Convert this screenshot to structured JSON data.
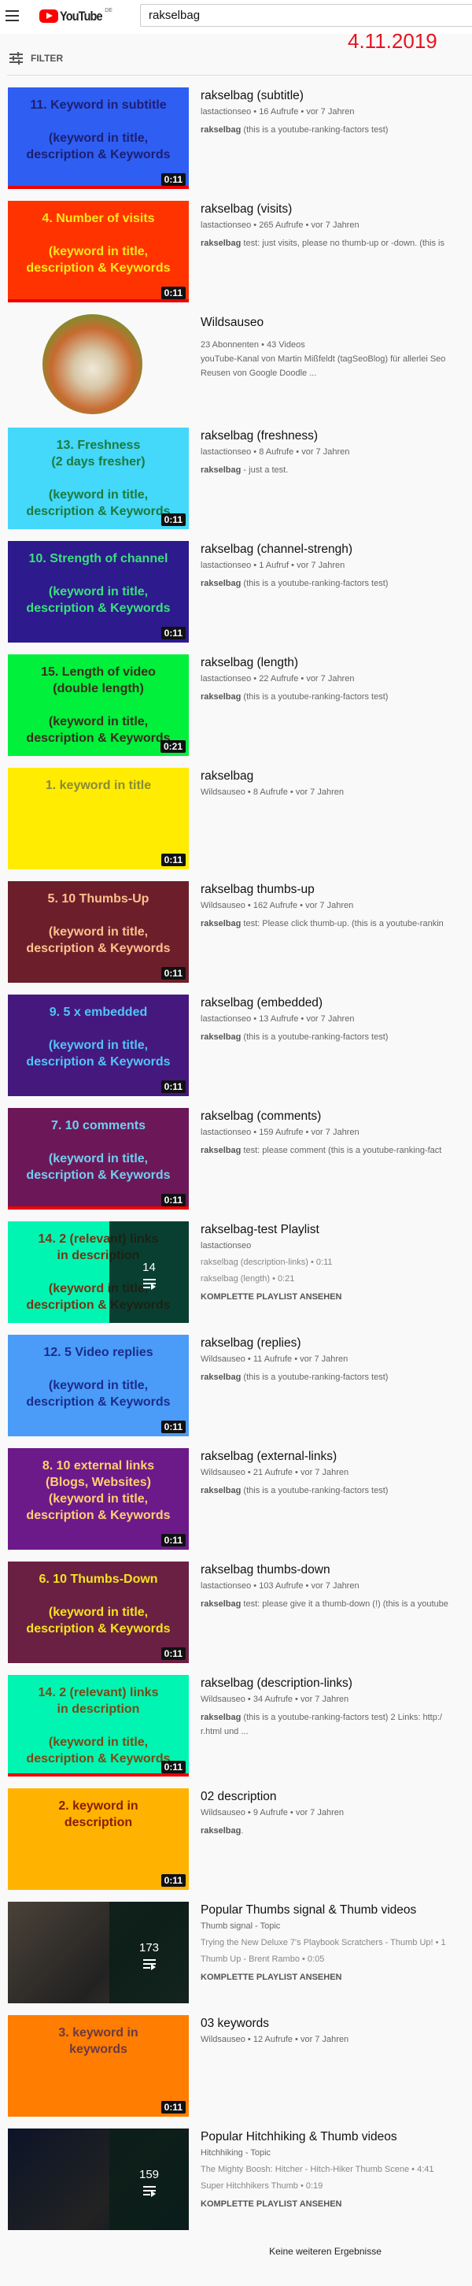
{
  "header": {
    "logo_text": "YouTube",
    "logo_region": "DE",
    "search_value": "rakselbag",
    "date_overlay": "4.11.2019",
    "filter_label": "FILTER"
  },
  "colors": {
    "accent": "#ff0000",
    "date": "#e8141e",
    "progress": "#ee0000"
  },
  "results": [
    {
      "type": "video",
      "title": "rakselbag (subtitle)",
      "channel": "lastactionseo",
      "views": "16 Aufrufe",
      "age": "vor 7 Jahren",
      "desc_bold": "rakselbag",
      "desc_rest": " (this is a youtube-ranking-factors test)",
      "thumb_text": "11. Keyword in subtitle\n\n(keyword in title,\ndescription & Keywords",
      "thumb_bg": "#2f5ef2",
      "thumb_fg": "#1c1f73",
      "duration": "0:11",
      "watched": true
    },
    {
      "type": "video",
      "title": "rakselbag (visits)",
      "channel": "lastactionseo",
      "views": "265 Aufrufe",
      "age": "vor 7 Jahren",
      "desc_bold": "rakselbag",
      "desc_rest": " test: just visits, please no thumb-up or -down. (this is",
      "thumb_text": "4. Number of visits\n\n(keyword in title,\ndescription & Keywords",
      "thumb_bg": "#ff3300",
      "thumb_fg": "#ffe81a",
      "duration": "0:11",
      "watched": true
    },
    {
      "type": "channel",
      "title": "Wildsauseo",
      "meta": "23 Abonnenten • 43 Videos",
      "desc_lines": [
        "youTube-Kanal von Martin Mißfeldt (tagSeoBlog) für allerlei Seo",
        "Reusen von Google Doodle ..."
      ]
    },
    {
      "type": "video",
      "title": "rakselbag (freshness)",
      "channel": "lastactionseo",
      "views": "8 Aufrufe",
      "age": "vor 7 Jahren",
      "desc_bold": "rakselbag",
      "desc_rest": " - just a test.",
      "thumb_text": "13. Freshness\n(2 days fresher)\n\n(keyword in title,\ndescription & Keywords",
      "thumb_bg": "#44d8fa",
      "thumb_fg": "#1e7a3c",
      "duration": "0:11",
      "watched": false
    },
    {
      "type": "video",
      "title": "rakselbag (channel-strengh)",
      "channel": "lastactionseo",
      "views": "1 Aufruf",
      "age": "vor 7 Jahren",
      "desc_bold": "rakselbag",
      "desc_rest": " (this is a youtube-ranking-factors test)",
      "thumb_text": "10. Strength of channel\n\n(keyword in title,\ndescription & Keywords",
      "thumb_bg": "#2d1a8c",
      "thumb_fg": "#3ae07e",
      "duration": "0:11",
      "watched": false
    },
    {
      "type": "video",
      "title": "rakselbag (length)",
      "channel": "lastactionseo",
      "views": "22 Aufrufe",
      "age": "vor 7 Jahren",
      "desc_bold": "rakselbag",
      "desc_rest": " (this is a youtube-ranking-factors test)",
      "thumb_text": "15. Length of video\n(double length)\n\n(keyword in title,\ndescription & Keywords",
      "thumb_bg": "#00f03c",
      "thumb_fg": "#3a2c1c",
      "duration": "0:21",
      "watched": false
    },
    {
      "type": "video",
      "title": "rakselbag",
      "channel": "Wildsauseo",
      "views": "8 Aufrufe",
      "age": "vor 7 Jahren",
      "desc_bold": "",
      "desc_rest": "",
      "thumb_text": "1. keyword in title",
      "thumb_bg": "#ffec00",
      "thumb_fg": "#8a8a3a",
      "duration": "0:11",
      "watched": false
    },
    {
      "type": "video",
      "title": "rakselbag thumbs-up",
      "channel": "Wildsauseo",
      "views": "162 Aufrufe",
      "age": "vor 7 Jahren",
      "desc_bold": "rakselbag",
      "desc_rest": " test: Please click thumb-up. (this is a youtube-rankin",
      "thumb_text": "5. 10 Thumbs-Up\n\n(keyword in title,\ndescription & Keywords",
      "thumb_bg": "#6c1f2b",
      "thumb_fg": "#ffc08c",
      "duration": "0:11",
      "watched": false
    },
    {
      "type": "video",
      "title": "rakselbag (embedded)",
      "channel": "lastactionseo",
      "views": "13 Aufrufe",
      "age": "vor 7 Jahren",
      "desc_bold": "rakselbag",
      "desc_rest": " (this is a youtube-ranking-factors test)",
      "thumb_text": "9. 5 x embedded\n\n(keyword in title,\ndescription & Keywords",
      "thumb_bg": "#45187e",
      "thumb_fg": "#52c4f5",
      "duration": "0:11",
      "watched": false
    },
    {
      "type": "video",
      "title": "rakselbag (comments)",
      "channel": "lastactionseo",
      "views": "159 Aufrufe",
      "age": "vor 7 Jahren",
      "desc_bold": "rakselbag",
      "desc_rest": " test: please comment (this is a youtube-ranking-fact",
      "thumb_text": "7. 10 comments\n\n(keyword in title,\ndescription & Keywords",
      "thumb_bg": "#6c1858",
      "thumb_fg": "#6fcff0",
      "duration": "0:11",
      "watched": true
    },
    {
      "type": "playlist",
      "title": "rakselbag-test Playlist",
      "channel": "lastactionseo",
      "videos": [
        "rakselbag (description-links) • 0:11",
        "rakselbag (length) • 0:21"
      ],
      "link": "KOMPLETTE PLAYLIST ANSEHEN",
      "count": "14",
      "thumb_text": "14. 2 (relevant) links\nin description\n\n(keyword in title,\ndescription & Keywords",
      "thumb_bg": "#00f5b2",
      "thumb_fg": "#7a3412"
    },
    {
      "type": "video",
      "title": "rakselbag (replies)",
      "channel": "Wildsauseo",
      "views": "11 Aufrufe",
      "age": "vor 7 Jahren",
      "desc_bold": "rakselbag",
      "desc_rest": " (this is a youtube-ranking-factors test)",
      "thumb_text": "12. 5 Video replies\n\n(keyword in title,\ndescription & Keywords",
      "thumb_bg": "#4a9cf8",
      "thumb_fg": "#1c2c8c",
      "duration": "0:11",
      "watched": false
    },
    {
      "type": "video",
      "title": "rakselbag (external-links)",
      "channel": "Wildsauseo",
      "views": "21 Aufrufe",
      "age": "vor 7 Jahren",
      "desc_bold": "rakselbag",
      "desc_rest": " (this is a youtube-ranking-factors test)",
      "thumb_text": "8. 10 external links\n(Blogs, Websites)\n(keyword in title,\ndescription & Keywords",
      "thumb_bg": "#6c1a8a",
      "thumb_fg": "#ffd070",
      "duration": "0:11",
      "watched": false
    },
    {
      "type": "video",
      "title": "rakselbag thumbs-down",
      "channel": "lastactionseo",
      "views": "103 Aufrufe",
      "age": "vor 7 Jahren",
      "desc_bold": "rakselbag",
      "desc_rest": " test: please give it a thumb-down (!) (this is a youtube",
      "thumb_text": "6. 10 Thumbs-Down\n\n(keyword in title,\ndescription & Keywords",
      "thumb_bg": "#6a2042",
      "thumb_fg": "#f5e31e",
      "duration": "0:11",
      "watched": false
    },
    {
      "type": "video",
      "title": "rakselbag (description-links)",
      "channel": "Wildsauseo",
      "views": "34 Aufrufe",
      "age": "vor 7 Jahren",
      "desc_bold": "rakselbag",
      "desc_rest": " (this is a youtube-ranking-factors test) 2 Links: http:/",
      "desc_line2": "r.html und ...",
      "thumb_text": "14. 2 (relevant) links\nin description\n\n(keyword in title,\ndescription & Keywords",
      "thumb_bg": "#00f5b2",
      "thumb_fg": "#7a4a14",
      "duration": "0:11",
      "watched": true
    },
    {
      "type": "video",
      "title": "02 description",
      "channel": "Wildsauseo",
      "views": "9 Aufrufe",
      "age": "vor 7 Jahren",
      "desc_bold": "rakselbag",
      "desc_rest": ".",
      "thumb_text": "2. keyword in\ndescription",
      "thumb_bg": "#ffb300",
      "thumb_fg": "#8a1c02",
      "duration": "0:11",
      "watched": false
    },
    {
      "type": "playlist",
      "title": "Popular Thumbs signal & Thumb videos",
      "channel": "Thumb signal - Topic",
      "videos": [
        "Trying the New Deluxe 7's Playbook Scratchers - Thumb Up! • 1",
        "Thumb Up - Brent Rambo • 0:05"
      ],
      "link": "KOMPLETTE PLAYLIST ANSEHEN",
      "count": "173",
      "thumb_text": "",
      "thumb_bg": "#4a4238",
      "thumb_fg": "#ffffff"
    },
    {
      "type": "video",
      "title": "03 keywords",
      "channel": "Wildsauseo",
      "views": "12 Aufrufe",
      "age": "vor 7 Jahren",
      "desc_bold": "",
      "desc_rest": "",
      "thumb_text": "3. keyword in\nkeywords",
      "thumb_bg": "#ff7d00",
      "thumb_fg": "#6a3a44",
      "duration": "0:11",
      "watched": false
    },
    {
      "type": "playlist",
      "title": "Popular Hitchhiking & Thumb videos",
      "channel": "Hitchhiking - Topic",
      "videos": [
        "The Mighty Boosh: Hitcher - Hitch-Hiker Thumb Scene • 4:41",
        "Super Hitchhikers Thumb • 0:19"
      ],
      "link": "KOMPLETTE PLAYLIST ANSEHEN",
      "count": "159",
      "thumb_text": "",
      "thumb_bg": "#0c1428",
      "thumb_fg": "#ffffff"
    }
  ],
  "footer": {
    "text": "Keine weiteren Ergebnisse"
  }
}
